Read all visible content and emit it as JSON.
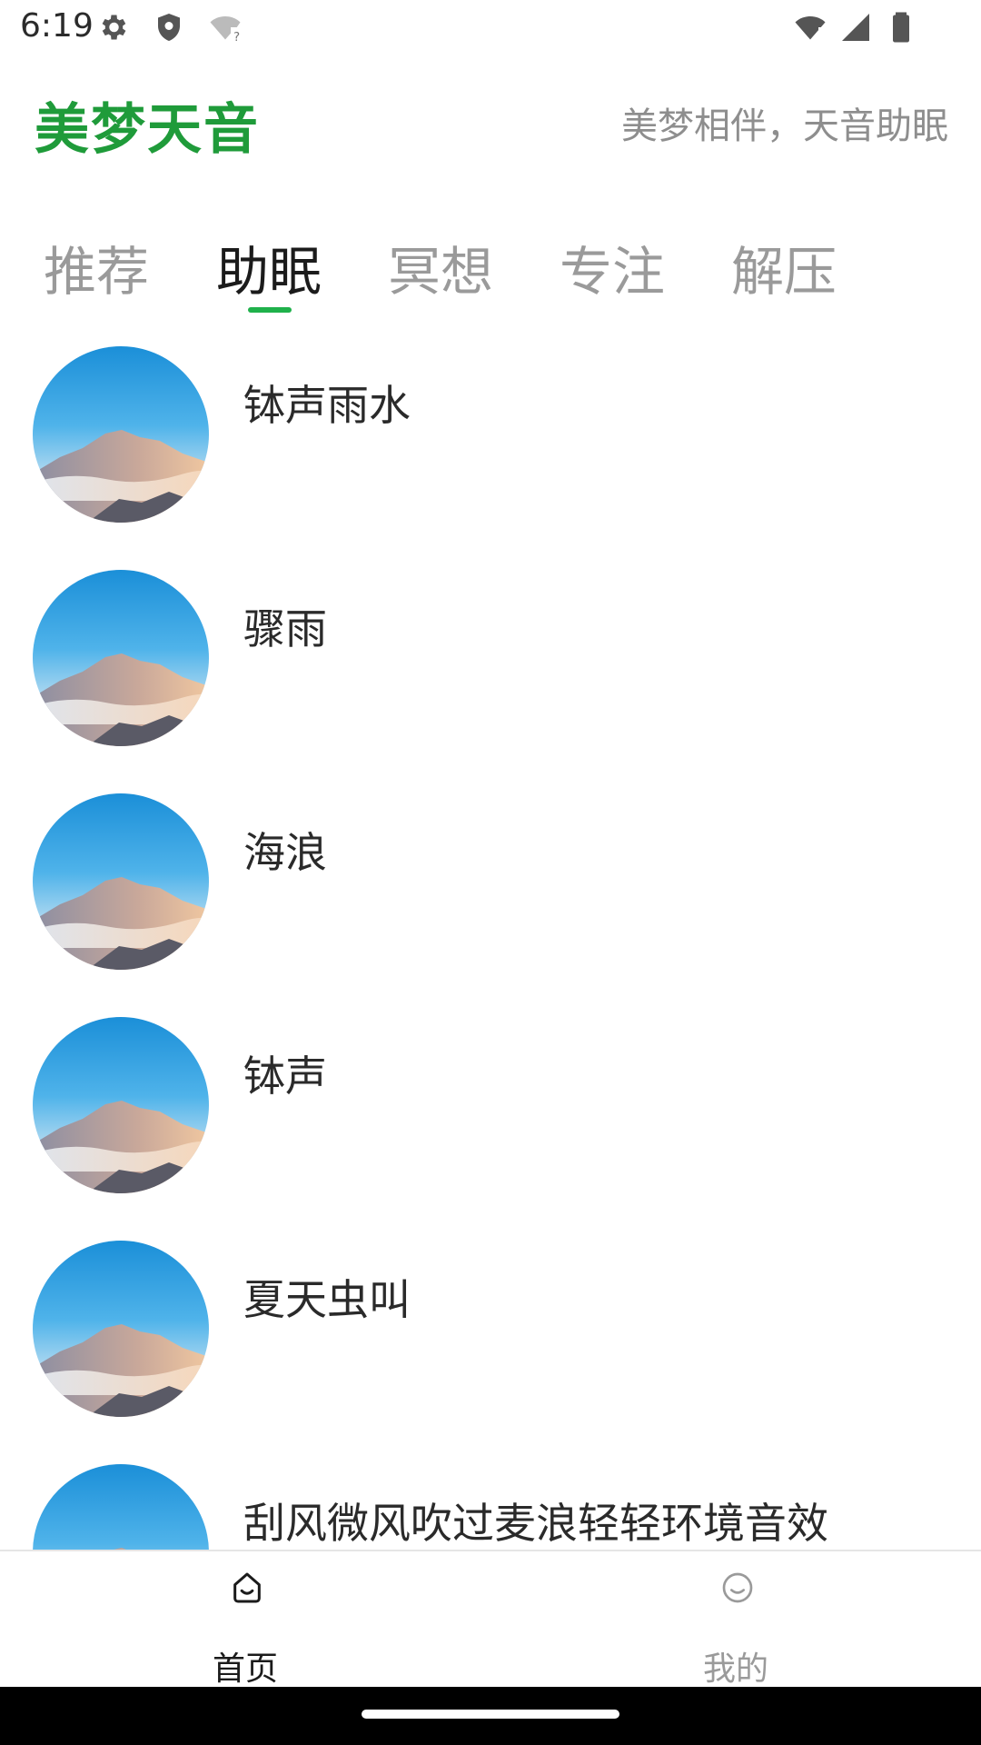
{
  "status_bar": {
    "time": "6:19",
    "icons": [
      "gear-icon",
      "shield-icon",
      "wifi-unknown-icon",
      "wifi-icon",
      "signal-icon",
      "battery-icon"
    ]
  },
  "header": {
    "logo_text": "美梦天音",
    "slogan": "美梦相伴，天音助眠",
    "logo_color": "#1f9b3a"
  },
  "tabs": [
    {
      "label": "推荐",
      "active": false
    },
    {
      "label": "助眠",
      "active": true
    },
    {
      "label": "冥想",
      "active": false
    },
    {
      "label": "专注",
      "active": false
    },
    {
      "label": "解压",
      "active": false
    }
  ],
  "accent_color": "#1fb14b",
  "list": [
    {
      "title": "钵声雨水",
      "thumb": "mountain-landscape-image"
    },
    {
      "title": "骤雨",
      "thumb": "mountain-landscape-image"
    },
    {
      "title": "海浪",
      "thumb": "mountain-landscape-image"
    },
    {
      "title": "钵声",
      "thumb": "mountain-landscape-image"
    },
    {
      "title": "夏天虫叫",
      "thumb": "mountain-landscape-image"
    },
    {
      "title": "刮风微风吹过麦浪轻轻环境音效",
      "thumb": "mountain-landscape-image"
    }
  ],
  "bottom_nav": [
    {
      "label": "首页",
      "icon": "home-face-icon",
      "active": true
    },
    {
      "label": "我的",
      "icon": "smile-icon",
      "active": false
    }
  ]
}
